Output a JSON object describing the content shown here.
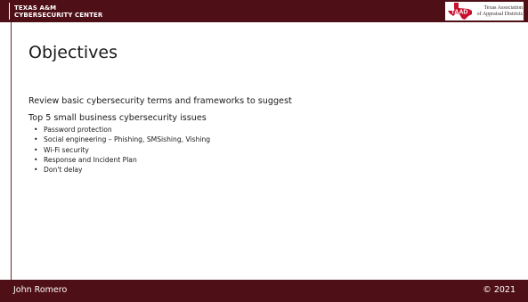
{
  "header": {
    "org_line1": "TEXAS A&M",
    "org_line2": "CYBERSECURITY CENTER",
    "partner_logo": {
      "icon": "texas-state-outline-icon",
      "abbrev": "TAAD",
      "name_line1": "Texas Association",
      "name_line2": "of Appraisal Districts"
    }
  },
  "slide": {
    "title": "Objectives",
    "paragraphs": [
      "Review basic cybersecurity  terms and frameworks to suggest",
      "Top 5 small business cybersecurity  issues"
    ],
    "bullet_marker": "•",
    "bullets": [
      "Password protection",
      "Social engineering  – Phishing,  SMSishing,  Vishing",
      "Wi-Fi security",
      "Response and Incident Plan",
      "Don't delay"
    ]
  },
  "footer": {
    "presenter": "John Romero",
    "copyright": "© 2021"
  },
  "colors": {
    "header_bar": "#4f0f16",
    "footer_bar": "#4f0f16",
    "taad_red": "#c8102e",
    "text": "#1a1a1a"
  }
}
